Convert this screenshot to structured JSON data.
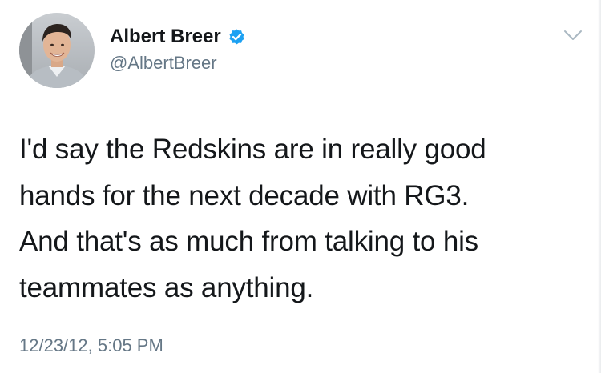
{
  "author": {
    "display_name": "Albert Breer",
    "handle": "@AlbertBreer",
    "verified": true,
    "verified_icon": "verified-badge-icon",
    "verified_color": "#1da1f2"
  },
  "tweet": {
    "lines": [
      "I'd say the Redskins are in really good",
      "hands for the next decade with RG3.",
      "And that's as much from talking to his",
      "teammates as anything."
    ],
    "timestamp": "12/23/12, 5:05 PM"
  },
  "menu": {
    "icon": "chevron-down-icon"
  }
}
